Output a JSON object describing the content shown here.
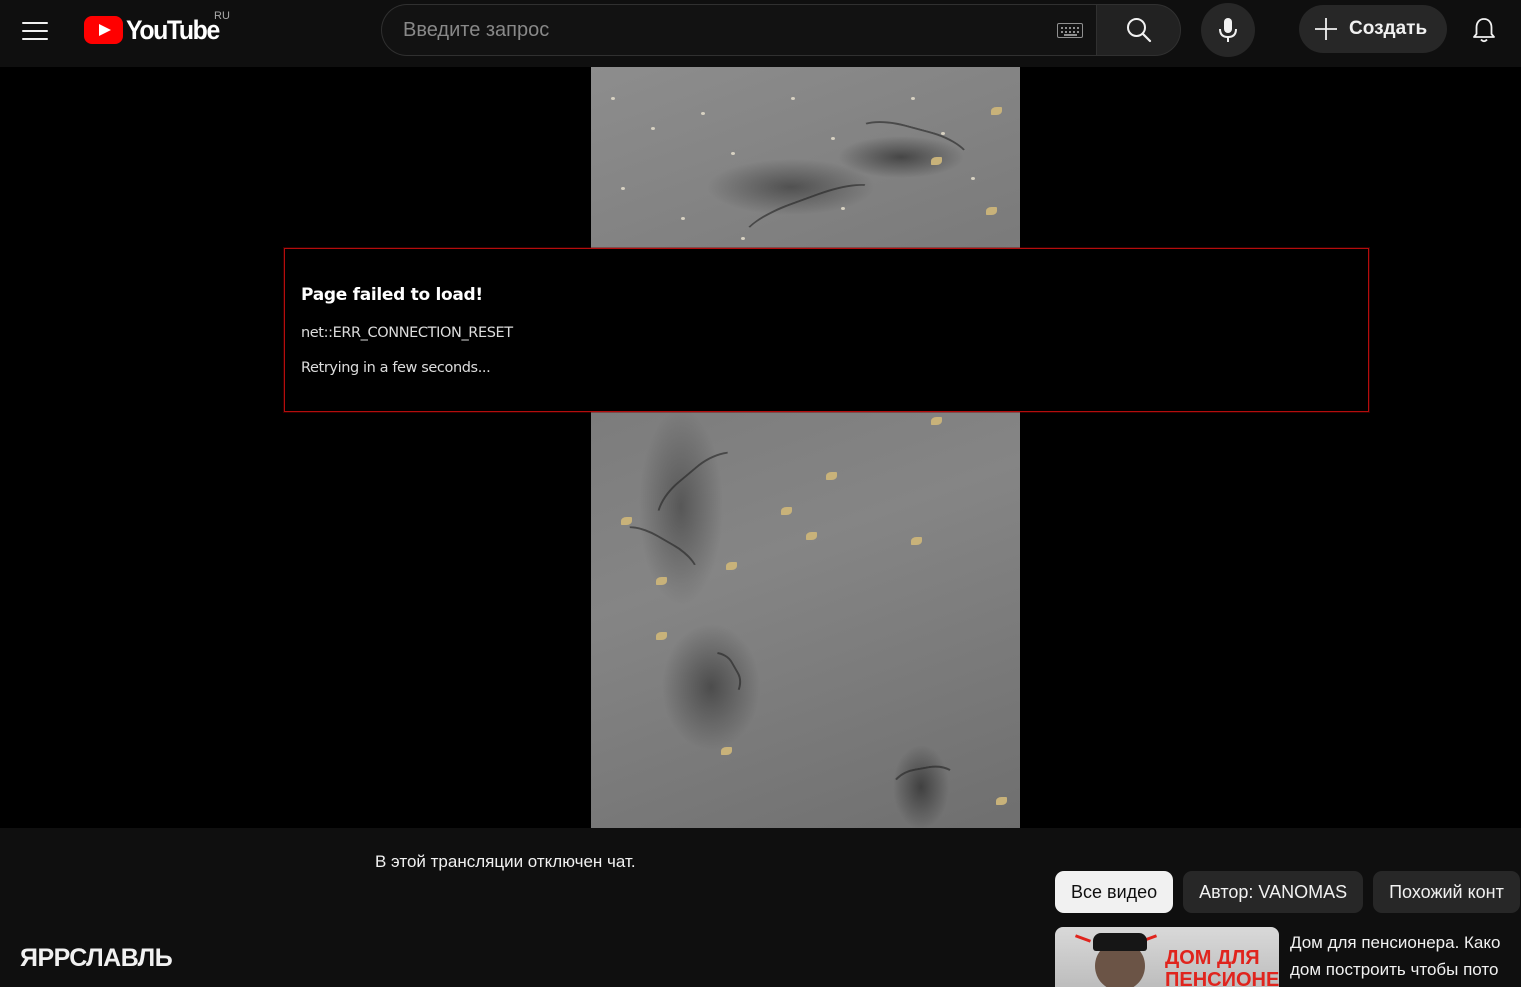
{
  "header": {
    "logo_text": "YouTube",
    "country_code": "RU",
    "search_placeholder": "Введите запрос",
    "create_label": "Создать"
  },
  "player": {
    "error": {
      "title": "Page failed to load!",
      "code": "net::ERR_CONNECTION_RESET",
      "retry": "Retrying in a few seconds..."
    },
    "error_border_color": "#b40d0d"
  },
  "below_player": {
    "chat_disabled": "В этой трансляции отключен чат.",
    "video_title": "ЯРРСЛАВЛЬ"
  },
  "related": {
    "chips": [
      {
        "label": "Все видео",
        "active": true
      },
      {
        "label": "Автор: VANOMAS",
        "active": false
      },
      {
        "label": "Похожий конт",
        "active": false
      }
    ],
    "items": [
      {
        "title_line1": "Дом для пенсионера. Како",
        "title_line2": "дом построить чтобы пото",
        "thumb_text_line1": "ДОМ ДЛЯ",
        "thumb_text_line2": "ПЕНСИОНЕРА"
      }
    ]
  },
  "colors": {
    "brand_red": "#ff0000",
    "background": "#0f0f0f",
    "chip_bg": "#272727"
  }
}
